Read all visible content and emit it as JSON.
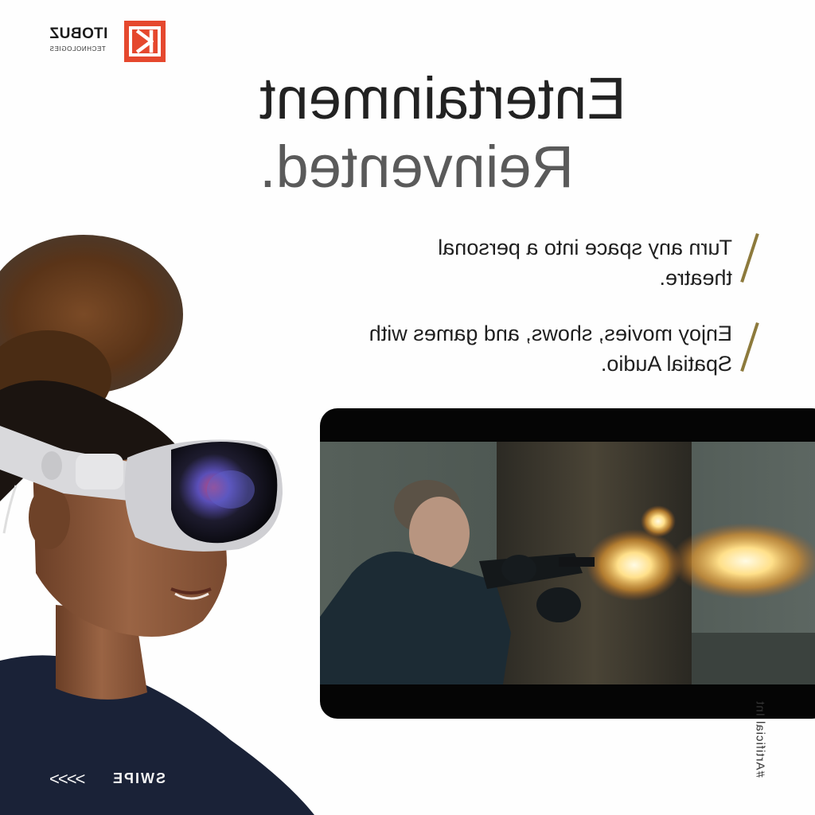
{
  "brand": {
    "name": "ITOBUZ",
    "subtitle": "TECHNOLOGIES",
    "accent_color": "#e5482e"
  },
  "headline": {
    "line1": "Entertainment",
    "line2": "Reinvented."
  },
  "bullets": [
    {
      "text": "Turn any space into a personal theatre."
    },
    {
      "text": "Enjoy movies, shows, and games with Spatial Audio."
    }
  ],
  "vertical_tag": "#Artificial Int",
  "swipe": {
    "label": "SWIPE",
    "arrows": "<<<<"
  },
  "colors": {
    "background": "#fefefe",
    "headline_dark": "#222222",
    "headline_muted": "#5a5a5a",
    "slash_gold": "#8d7a3c"
  }
}
